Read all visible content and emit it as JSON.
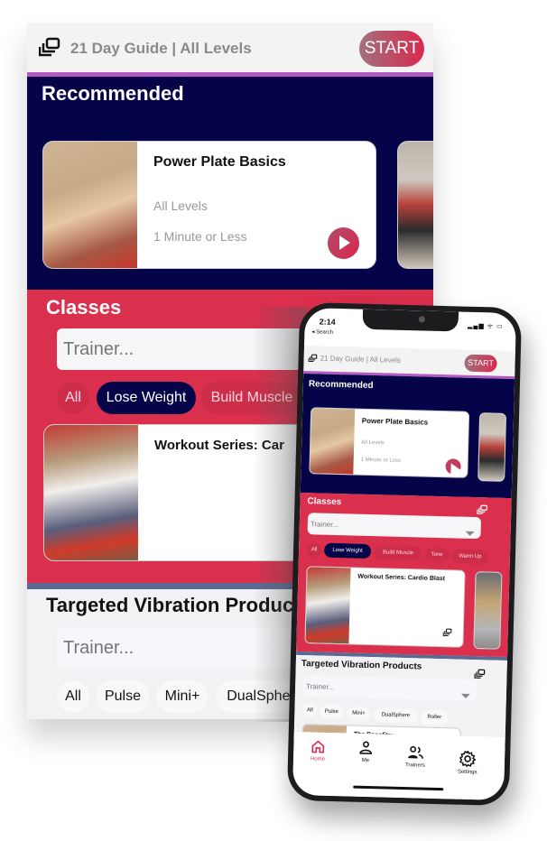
{
  "header": {
    "guide_text": "21 Day Guide | All Levels",
    "start_label": "START",
    "stack_icon": "stack-icon"
  },
  "recommended": {
    "title": "Recommended",
    "cards": [
      {
        "title": "Power Plate Basics",
        "level": "All Levels",
        "duration": "1 Minute or Less",
        "image": "trainer-blonde-portrait"
      },
      {
        "title": "",
        "image": "trainer-blonde-standing"
      }
    ]
  },
  "classes": {
    "title": "Classes",
    "trainer_placeholder": "Trainer...",
    "filters": [
      "All",
      "Lose Weight",
      "Build Muscle",
      "Tone",
      "Warm Up"
    ],
    "active_filter": "Lose Weight",
    "cards": [
      {
        "title": "Workout Series: Cardio Blast",
        "title_truncated": "Workout Series: Car",
        "image": "trainer-brunette-plate"
      },
      {
        "title": "",
        "image": "trainer-plate"
      }
    ]
  },
  "targeted": {
    "title": "Targeted Vibration Products",
    "title_truncated": "Targeted Vibration Produc",
    "trainer_placeholder": "Trainer...",
    "filters": [
      "All",
      "Pulse",
      "Mini+",
      "DualSphere",
      "Roller"
    ],
    "filters_truncated_last": "DualSpher",
    "cards": [
      {
        "title": "The Benefits:"
      }
    ]
  },
  "phone_status": {
    "time": "2:14",
    "back_label": "◂ Search",
    "icons": "▂▄▆ ᯤ ▭"
  },
  "tabbar": {
    "items": [
      {
        "label": "Home",
        "icon": "home-icon",
        "active": true
      },
      {
        "label": "Me",
        "icon": "person-icon",
        "active": false
      },
      {
        "label": "Trainers",
        "icon": "people-icon",
        "active": false
      },
      {
        "label": "Settings",
        "icon": "gear-icon",
        "active": false
      }
    ]
  },
  "colors": {
    "navy": "#050449",
    "crimson": "#da2f4d",
    "accent_purple": "#b45bc3",
    "start_gradient_end": "#d9294e",
    "separator": "#5b6a93"
  }
}
